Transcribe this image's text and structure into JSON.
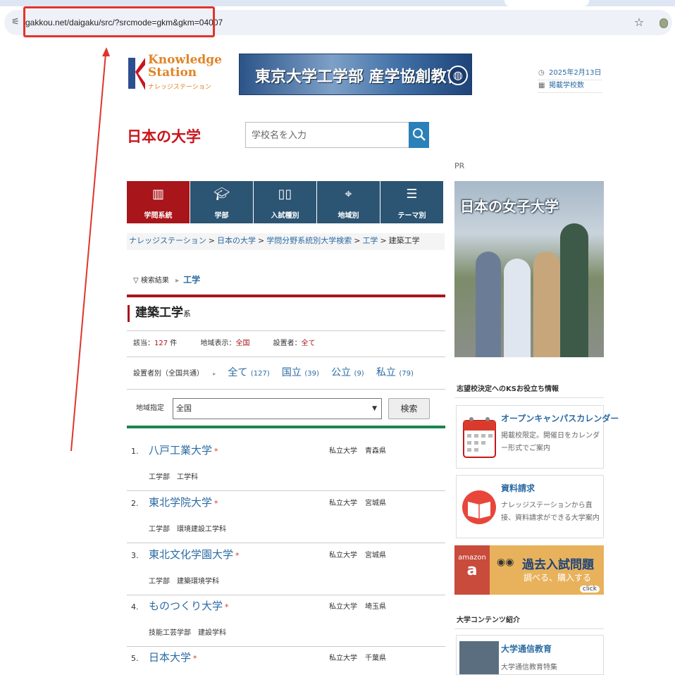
{
  "browser": {
    "url": "gakkou.net/daigaku/src/?srcmode=gkm&gkm=04007"
  },
  "header": {
    "logo_line1": "Knowledge",
    "logo_line2": "Station",
    "logo_kana": "ナレッジステーション",
    "banner_text": "東京大学工学部 産学協創教育",
    "date": "2025年2月13日",
    "listed_schools_link": "掲載学校数",
    "site_title": "日本の大学",
    "search_placeholder": "学校名を入力"
  },
  "nav": {
    "tabs": [
      {
        "label": "学問系統"
      },
      {
        "label": "学部"
      },
      {
        "label": "入試種別"
      },
      {
        "label": "地域別"
      },
      {
        "label": "テーマ別"
      }
    ]
  },
  "breadcrumb": {
    "items": [
      "ナレッジステーション",
      "日本の大学",
      "学問分野系統別大学検索",
      "工学"
    ],
    "current": "建築工学",
    "separator": ">"
  },
  "results": {
    "prefix": "▽ 検索結果",
    "arrow": "▸",
    "category_link": "工学",
    "heading": "建築工学",
    "heading_suffix": "系",
    "count_label": "該当：",
    "count_value": "127",
    "count_unit": "件",
    "region_display_label": "地域表示：",
    "region_display_value": "全国",
    "founder_label": "設置者：",
    "founder_value": "全て",
    "filter_label": "設置者別（全国共通）",
    "filter_arrow": "▸",
    "filters": [
      {
        "label": "全て",
        "count": "(127)"
      },
      {
        "label": "国立",
        "count": "(39)"
      },
      {
        "label": "公立",
        "count": "(9)"
      },
      {
        "label": "私立",
        "count": "(79)"
      }
    ],
    "region_label": "地域指定",
    "region_selected": "全国",
    "search_button": "検索"
  },
  "universities": [
    {
      "num": "1.",
      "name": "八戸工業大学",
      "type": "私立大学",
      "pref": "青森県",
      "dept": "工学部　工学科"
    },
    {
      "num": "2.",
      "name": "東北学院大学",
      "type": "私立大学",
      "pref": "宮城県",
      "dept": "工学部　環境建設工学科"
    },
    {
      "num": "3.",
      "name": "東北文化学園大学",
      "type": "私立大学",
      "pref": "宮城県",
      "dept": "工学部　建築環境学科"
    },
    {
      "num": "4.",
      "name": "ものつくり大学",
      "type": "私立大学",
      "pref": "埼玉県",
      "dept": "技能工芸学部　建設学科"
    },
    {
      "num": "5.",
      "name": "日本大学",
      "type": "私立大学",
      "pref": "千葉県",
      "dept": ""
    }
  ],
  "sidebar": {
    "pr_label": "PR",
    "ad_title": "日本の女子大学",
    "section1_title": "志望校決定へのKSお役立ち情報",
    "card1_title": "オープンキャンパスカレンダー",
    "card1_desc": "掲載校限定。開催日をカレンダー形式でご案内",
    "card2_title": "資料請求",
    "card2_desc": "ナレッジステーションから直接、資料請求ができる大学案内",
    "amazon_label": "amazon",
    "amazon_a": "a",
    "amazon_title": "過去入試問題",
    "amazon_sub": "調べる、購入する",
    "amazon_click": "click",
    "section2_title": "大学コンテンツ紹介",
    "card3_title": "大学通信教育",
    "card3_desc": "大学通信教育特集"
  },
  "colors": {
    "accent_red": "#a8151b",
    "nav_blue": "#2c5473",
    "link_blue": "#2b6ba3",
    "green_bar": "#1a8452",
    "annotation_red": "#e0352b"
  }
}
